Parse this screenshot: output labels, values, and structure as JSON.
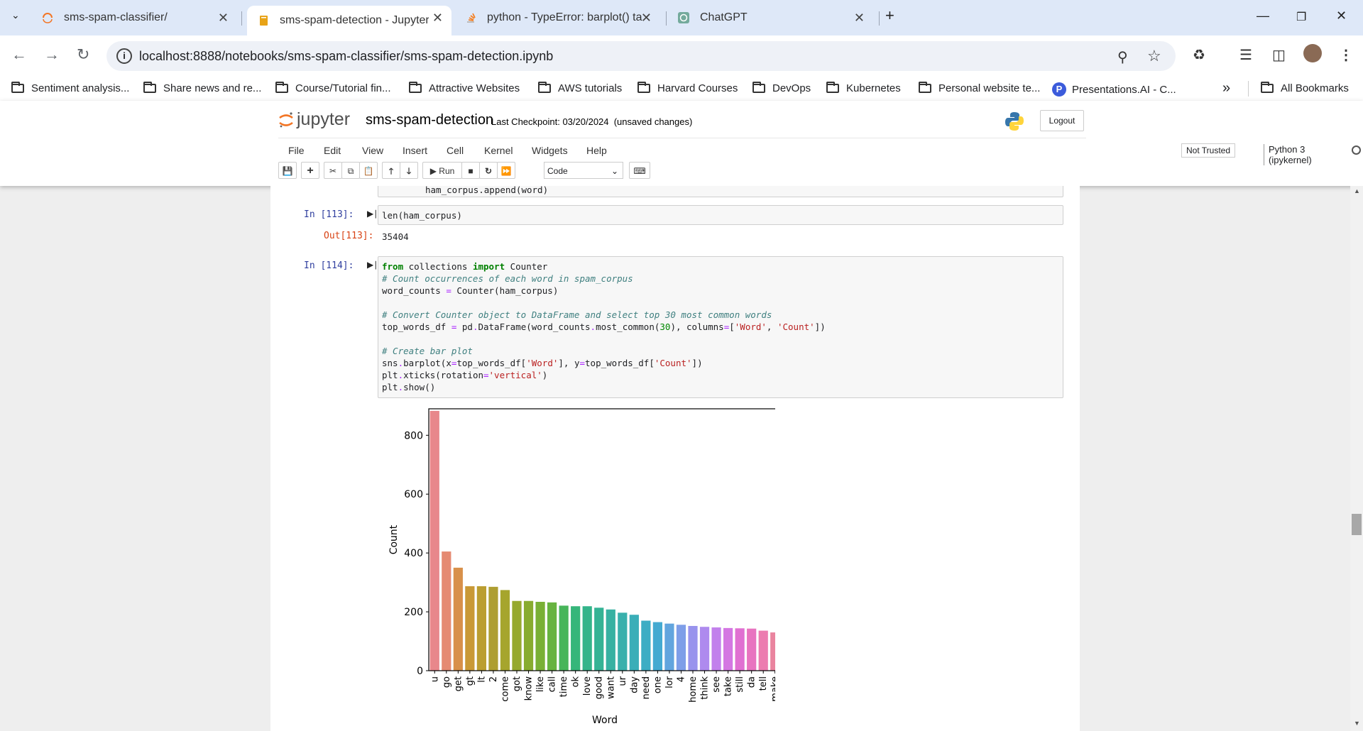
{
  "tabs": [
    {
      "title": "sms-spam-classifier/",
      "active": false
    },
    {
      "title": "sms-spam-detection - Jupyter N",
      "active": true
    },
    {
      "title": "python - TypeError: barplot() ta",
      "active": false
    },
    {
      "title": "ChatGPT",
      "active": false
    }
  ],
  "address": {
    "url": "localhost:8888/notebooks/sms-spam-classifier/sms-spam-detection.ipynb"
  },
  "bookmarks": [
    "Sentiment analysis...",
    "Share news and re...",
    "Course/Tutorial fin...",
    "Attractive Websites",
    "AWS tutorials",
    "Harvard Courses",
    "DevOps",
    "Kubernetes",
    "Personal website te...",
    "Presentations.AI - C...",
    "All Bookmarks"
  ],
  "jupyter": {
    "logo_text": "jupyter",
    "notebook_name": "sms-spam-detection",
    "checkpoint": "Last Checkpoint: 03/20/2024  (unsaved changes)",
    "logout": "Logout",
    "menu": [
      "File",
      "Edit",
      "View",
      "Insert",
      "Cell",
      "Kernel",
      "Widgets",
      "Help"
    ],
    "trust": "Not Trusted",
    "kernel": "Python 3 (ipykernel)",
    "run_label": "Run",
    "cell_type": "Code"
  },
  "cells": {
    "partial_line": "ham_corpus.append(word)",
    "in113_prompt": "In [113]:",
    "in113_code": "len(ham_corpus)",
    "out113_prompt": "Out[113]:",
    "out113_value": "35404",
    "in114_prompt": "In [114]:"
  },
  "chart_data": {
    "type": "bar",
    "xlabel": "Word",
    "ylabel": "Count",
    "ylim": [
      0,
      890
    ],
    "yticks": [
      0,
      200,
      400,
      600,
      800
    ],
    "categories": [
      "u",
      "go",
      "get",
      "gt",
      "lt",
      "2",
      "come",
      "got",
      "know",
      "like",
      "call",
      "time",
      "ok",
      "love",
      "good",
      "want",
      "ur",
      "day",
      "need",
      "one",
      "lor",
      "4",
      "home",
      "think",
      "see",
      "take",
      "still",
      "da",
      "tell",
      "make"
    ],
    "values": [
      883,
      405,
      350,
      287,
      287,
      285,
      274,
      237,
      237,
      234,
      232,
      221,
      219,
      219,
      214,
      208,
      197,
      190,
      170,
      165,
      160,
      156,
      152,
      149,
      147,
      145,
      144,
      143,
      136,
      130
    ],
    "colors": [
      "#e8878b",
      "#e58a72",
      "#d8904a",
      "#c99936",
      "#bb9e31",
      "#ae9e31",
      "#a6a52d",
      "#96a92e",
      "#88ac2f",
      "#79b035",
      "#67b340",
      "#47b55a",
      "#36b67a",
      "#34b48a",
      "#35b395",
      "#37b1a2",
      "#39b0ac",
      "#3aaeb8",
      "#3dadc4",
      "#44aad1",
      "#62a5de",
      "#7e9ee8",
      "#9893ed",
      "#ae8aee",
      "#c280ec",
      "#d477e2",
      "#e070d2",
      "#e874c0",
      "#ec7cb0",
      "#ea849f"
    ]
  }
}
